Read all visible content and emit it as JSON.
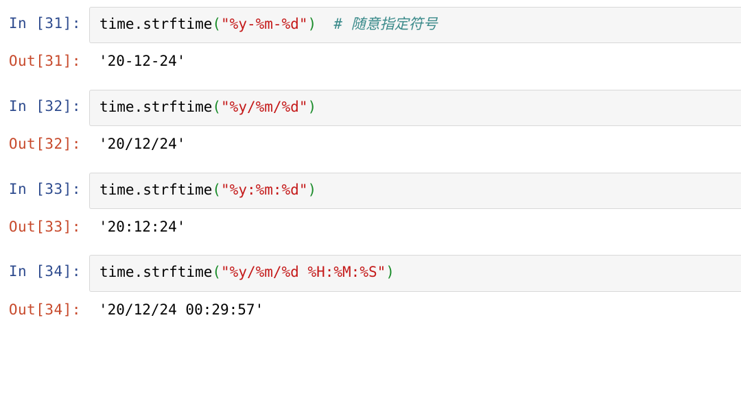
{
  "cells": [
    {
      "n": 31,
      "in_label": "In [31]:",
      "out_label": "Out[31]:",
      "code_prefix": "time.strftime",
      "paren_open": "(",
      "string": "\"%y-%m-%d\"",
      "paren_close": ")",
      "comment": "  # 随意指定符号",
      "output": "'20-12-24'"
    },
    {
      "n": 32,
      "in_label": "In [32]:",
      "out_label": "Out[32]:",
      "code_prefix": "time.strftime",
      "paren_open": "(",
      "string": "\"%y/%m/%d\"",
      "paren_close": ")",
      "comment": "",
      "output": "'20/12/24'"
    },
    {
      "n": 33,
      "in_label": "In [33]:",
      "out_label": "Out[33]:",
      "code_prefix": "time.strftime",
      "paren_open": "(",
      "string": "\"%y:%m:%d\"",
      "paren_close": ")",
      "comment": "",
      "output": "'20:12:24'"
    },
    {
      "n": 34,
      "in_label": "In [34]:",
      "out_label": "Out[34]:",
      "code_prefix": "time.strftime",
      "paren_open": "(",
      "string": "\"%y/%m/%d %H:%M:%S\"",
      "paren_close": ")",
      "comment": "",
      "output": "'20/12/24 00:29:57'"
    }
  ]
}
